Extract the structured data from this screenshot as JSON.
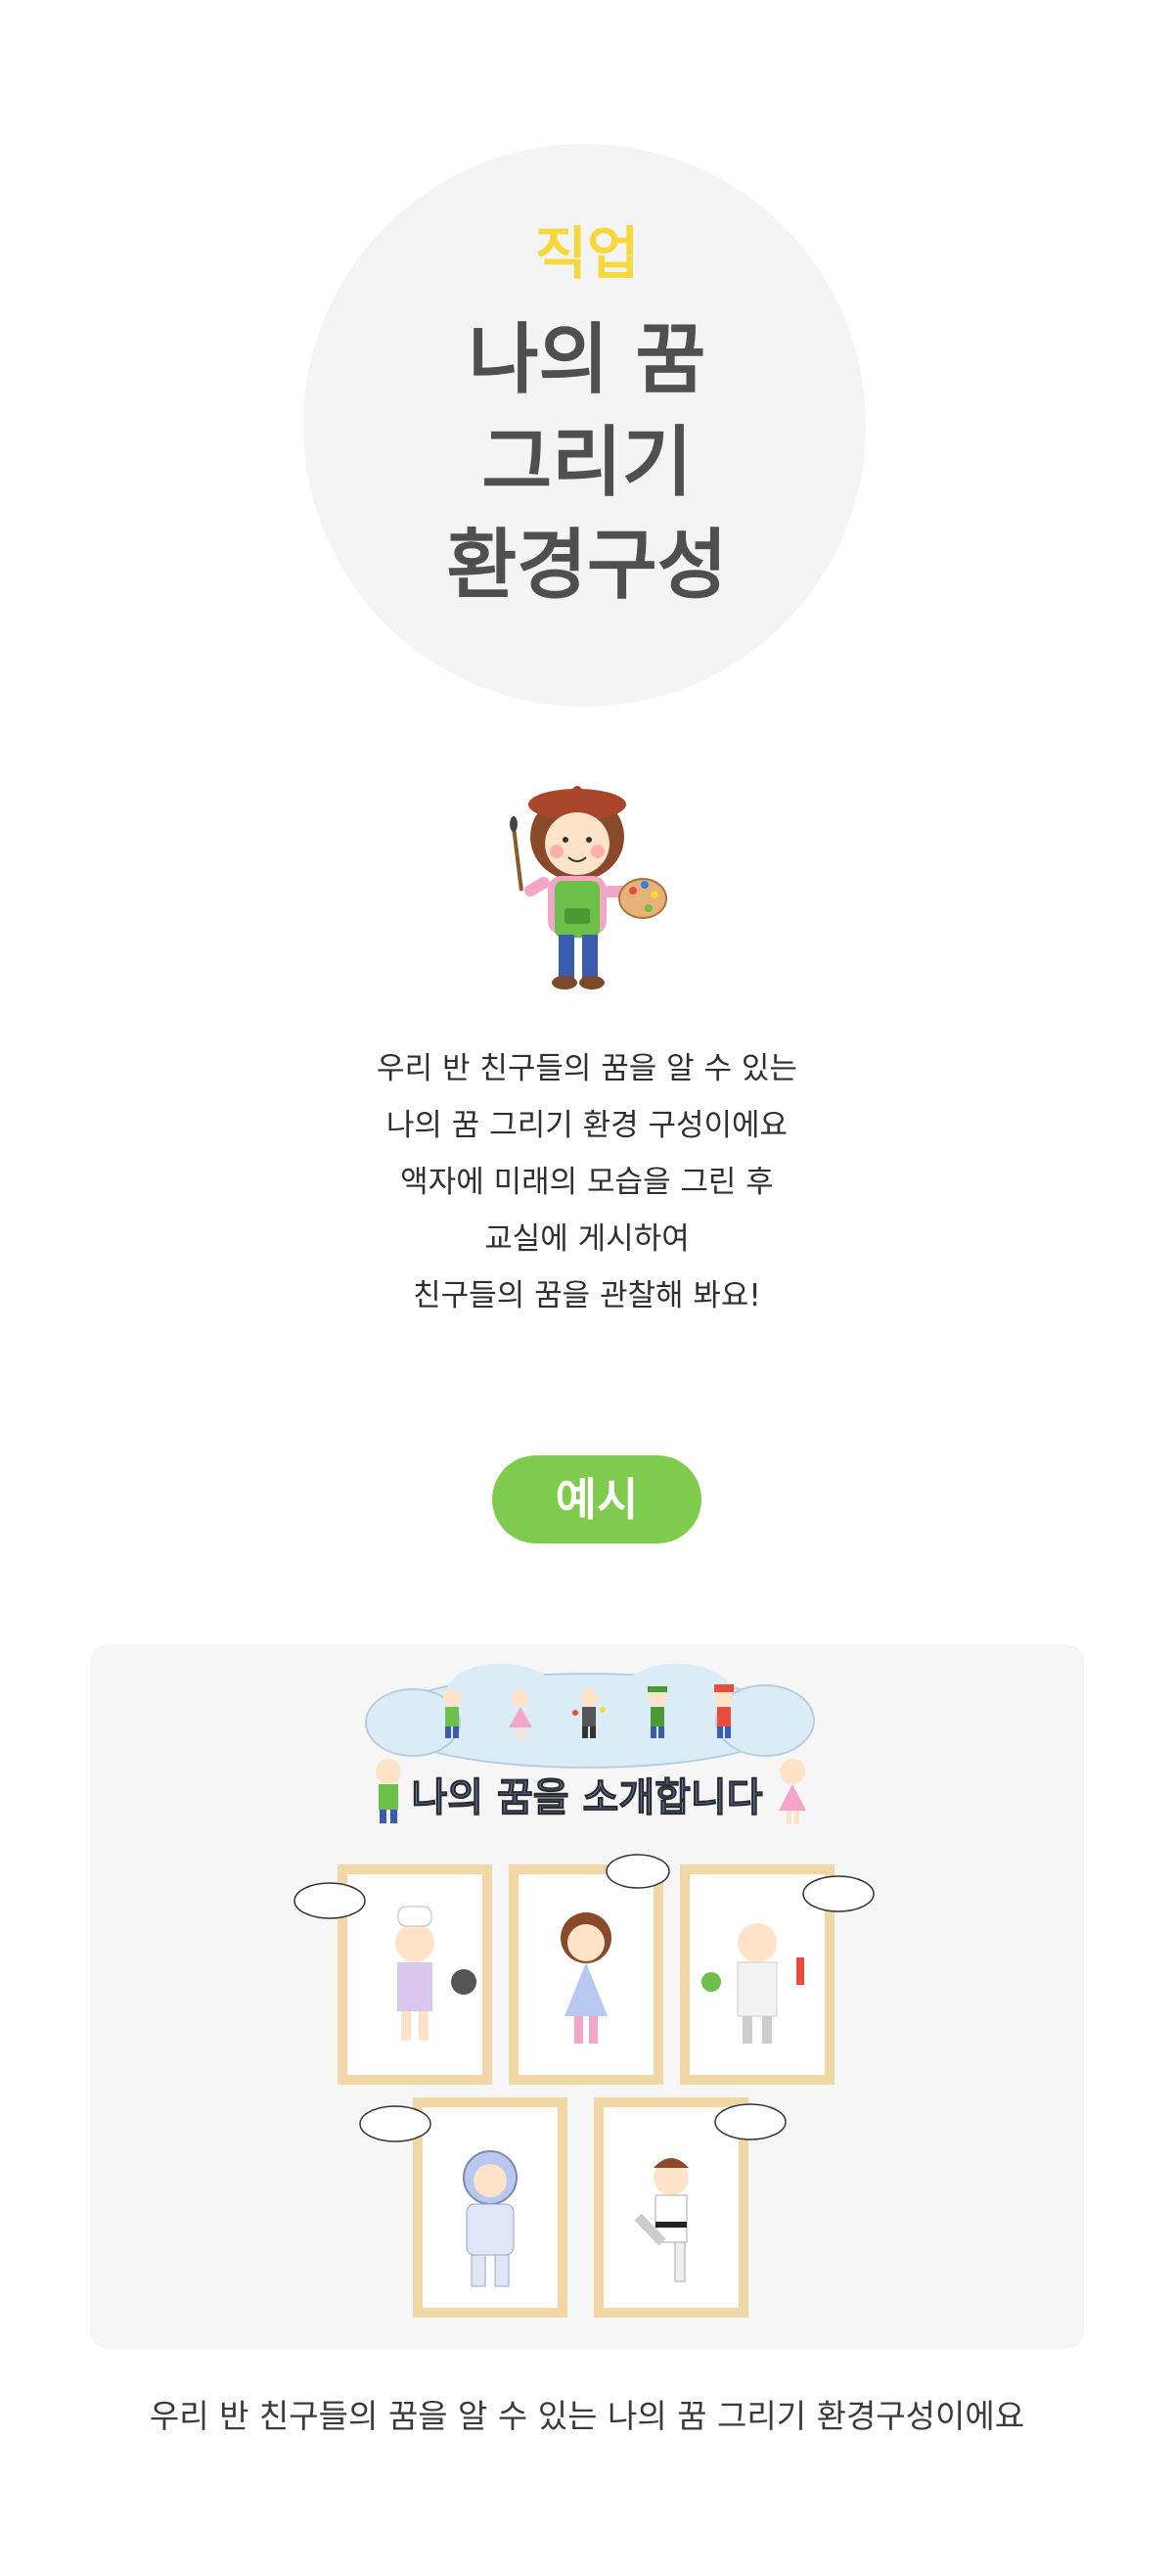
{
  "hero": {
    "category": "직업",
    "title_lines": [
      "나의 꿈",
      "그리기",
      "환경구성"
    ]
  },
  "description": [
    "우리 반 친구들의 꿈을 알 수 있는",
    "나의 꿈 그리기 환경 구성이에요",
    "액자에 미래의 모습을 그린 후",
    "교실에 게시하여",
    "친구들의 꿈을 관찰해 봐요!"
  ],
  "example_badge": "예시",
  "board_title": "나의 꿈을 소개합니다",
  "caption": "우리 반 친구들의 꿈을 알 수 있는 나의 꿈 그리기 환경구성이에요",
  "colors": {
    "category": "#f4d83c",
    "title": "#4f4f4f",
    "badge": "#7ecb4e",
    "panel": "#f6f6f6",
    "frame": "#f1d6a6"
  }
}
